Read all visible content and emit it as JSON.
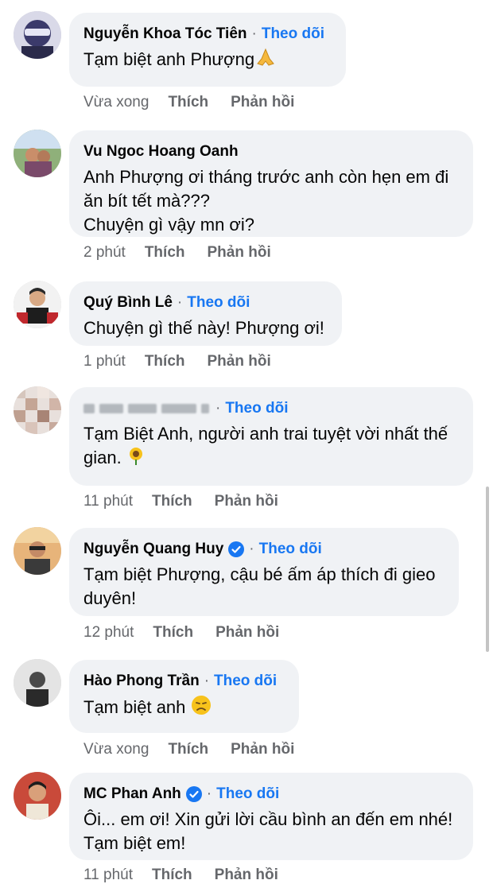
{
  "comments": [
    {
      "name": "Nguyễn Khoa Tóc Tiên",
      "follow": "Theo dõi",
      "text": [
        "Tạm biệt anh Phượng"
      ],
      "emoji": "folded-hands",
      "time": "Vừa xong",
      "like": "Thích",
      "reply": "Phản hồi"
    },
    {
      "name": "Vu Ngoc Hoang Oanh",
      "text": [
        "Anh Phượng ơi tháng trước anh còn hẹn em đi",
        "ăn bít tết mà???",
        "Chuyện gì vậy mn ơi?"
      ],
      "time": "2 phút",
      "like": "Thích",
      "reply": "Phản hồi"
    },
    {
      "name": "Quý Bình Lê",
      "follow": "Theo dõi",
      "text": [
        "Chuyện gì thế này! Phượng ơi!"
      ],
      "time": "1 phút",
      "like": "Thích",
      "reply": "Phản hồi"
    },
    {
      "name": "",
      "follow": "Theo dõi",
      "text": [
        "Tạm Biệt Anh, người anh trai tuyệt vời nhất thế",
        "gian."
      ],
      "emoji": "sunflower",
      "time": "11 phút",
      "like": "Thích",
      "reply": "Phản hồi"
    },
    {
      "name": "Nguyễn Quang Huy",
      "verified": true,
      "follow": "Theo dõi",
      "text": [
        "Tạm biệt Phượng, cậu bé ấm áp thích đi gieo",
        "duyên!"
      ],
      "time": "12 phút",
      "like": "Thích",
      "reply": "Phản hồi"
    },
    {
      "name": "Hào Phong Trần",
      "follow": "Theo dõi",
      "text": [
        "Tạm biệt anh"
      ],
      "emoji": "sad-face",
      "time": "Vừa xong",
      "like": "Thích",
      "reply": "Phản hồi"
    },
    {
      "name": "MC Phan Anh",
      "verified": true,
      "follow": "Theo dõi",
      "text": [
        "Ôi... em ơi! Xin gửi lời cầu bình an đến em nhé!",
        "Tạm biệt em!"
      ],
      "time": "11 phút",
      "like": "Thích",
      "reply": "Phản hồi"
    }
  ],
  "colors": {
    "bubble": "#f0f2f5",
    "link": "#1877f2",
    "meta": "#65676b"
  }
}
